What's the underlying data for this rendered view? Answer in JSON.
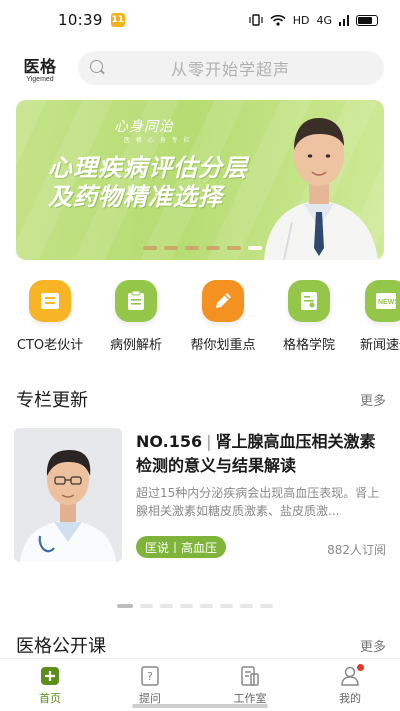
{
  "status_bar": {
    "time": "10:39",
    "app_badge": "11",
    "network": "HD",
    "signal": "4G"
  },
  "header": {
    "logo_cn": "医格",
    "logo_en": "Yigemed",
    "search_placeholder": "从零开始学超声"
  },
  "banner": {
    "brand": "心身同治",
    "brand_sub": "医 格 心 身 专 栏",
    "title_line1": "心理疾病评估分层",
    "title_line2": "及药物精准选择",
    "dots": 6,
    "active_dot": 5
  },
  "quick_nav": [
    {
      "label": "CTO老伙计",
      "icon": "folder-icon",
      "color": "#f7b526"
    },
    {
      "label": "病例解析",
      "icon": "clipboard-icon",
      "color": "#94c64a"
    },
    {
      "label": "帮你划重点",
      "icon": "pencil-icon",
      "color": "#f39221"
    },
    {
      "label": "格格学院",
      "icon": "certificate-icon",
      "color": "#94c64a"
    },
    {
      "label": "新闻速递",
      "icon": "news-icon",
      "color": "#94c64a"
    }
  ],
  "column_section": {
    "title": "专栏更新",
    "more": "更多"
  },
  "article": {
    "number": "NO.156",
    "title": "肾上腺高血压相关激素检测的意义与结果解读",
    "desc": "超过15种内分泌疾病会出现高血压表现。肾上腺相关激素如糖皮质激素、盐皮质激...",
    "tag": "匡说丨高血压",
    "subscribers": "882人订阅"
  },
  "course_section": {
    "title": "医格公开课",
    "more": "更多"
  },
  "tabs": [
    {
      "label": "首页",
      "icon": "home-plus-icon",
      "active": true
    },
    {
      "label": "提问",
      "icon": "question-icon",
      "active": false
    },
    {
      "label": "工作室",
      "icon": "studio-icon",
      "active": false
    },
    {
      "label": "我的",
      "icon": "profile-icon",
      "active": false
    }
  ],
  "colors": {
    "brand_green": "#7fb43b",
    "active_tab": "#5b8e1d",
    "banner_green": "#b6dc72",
    "notification_red": "#e23b2d"
  }
}
